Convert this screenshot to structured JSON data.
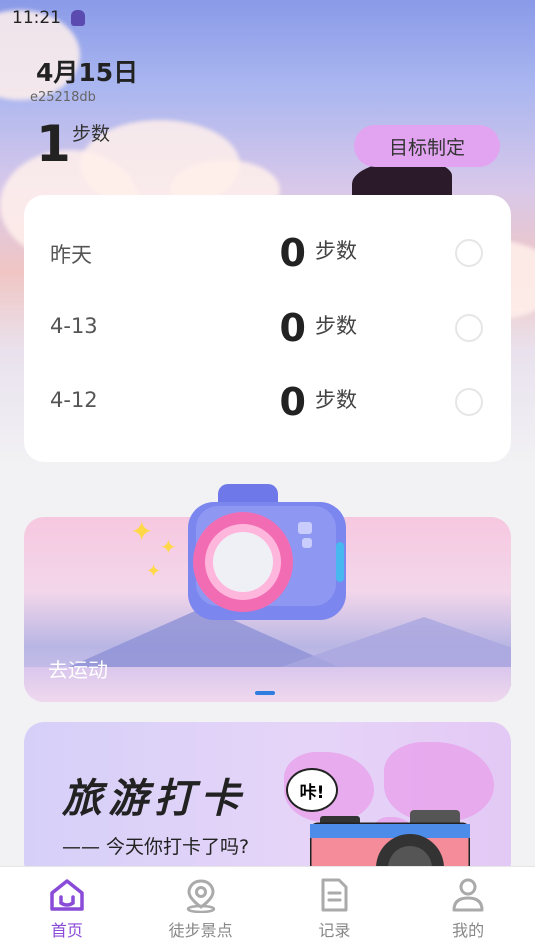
{
  "status_bar": {
    "time": "11:21"
  },
  "header": {
    "date": "4月15日",
    "device_id": "e25218db",
    "today_steps": "1",
    "today_unit": "步数",
    "goal_button": "目标制定"
  },
  "history": [
    {
      "label": "昨天",
      "value": "0",
      "unit": "步数"
    },
    {
      "label": "4-13",
      "value": "0",
      "unit": "步数"
    },
    {
      "label": "4-12",
      "value": "0",
      "unit": "步数"
    }
  ],
  "banner": {
    "label": "去运动"
  },
  "checkin": {
    "title": "旅游打卡",
    "subtitle": "—— 今天你打卡了吗?",
    "bubble": "咔!"
  },
  "tabs": [
    {
      "label": "首页",
      "icon": "home-icon",
      "active": true
    },
    {
      "label": "徒步景点",
      "icon": "location-icon",
      "active": false
    },
    {
      "label": "记录",
      "icon": "record-icon",
      "active": false
    },
    {
      "label": "我的",
      "icon": "profile-icon",
      "active": false
    }
  ],
  "colors": {
    "accent": "#8a4bd8",
    "goal_button": "#e2a4f0",
    "indicator": "#2f7de1"
  }
}
